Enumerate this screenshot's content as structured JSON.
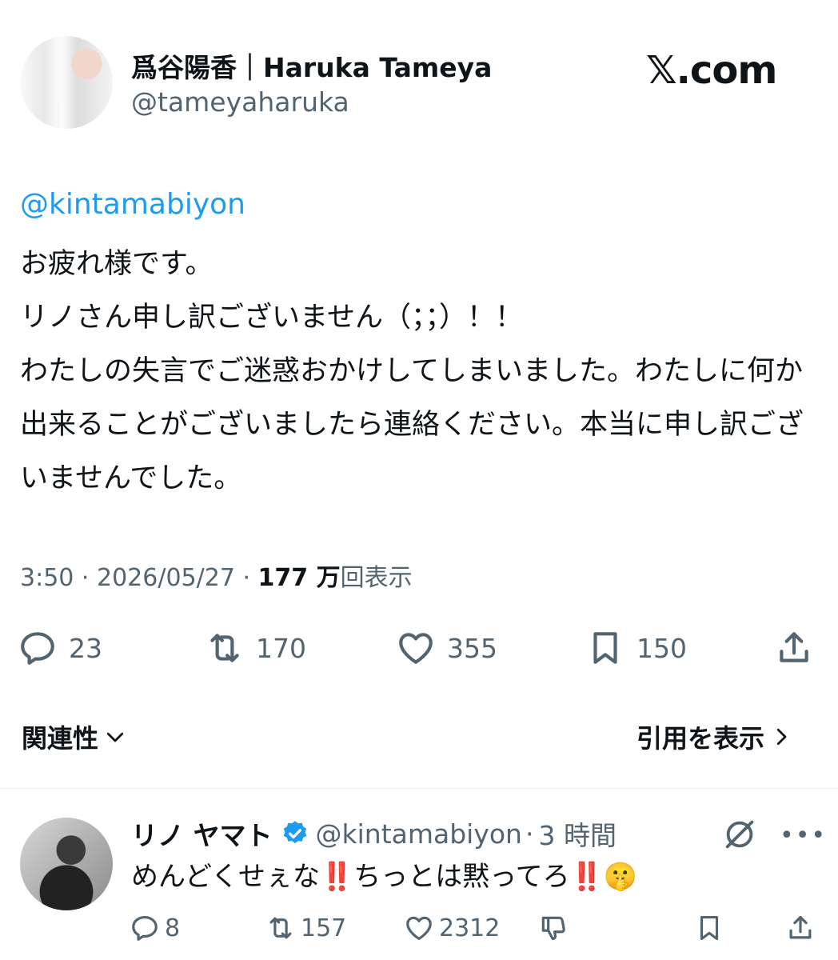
{
  "tweet": {
    "display_name": "爲谷陽香｜Haruka Tameya",
    "handle": "@tameyaharuka",
    "site_label": "𝕏.com",
    "mention": "@kintamabiyon",
    "body": "お疲れ様です。\nリノさん申し訳ございません（；；）！！\nわたしの失言でご迷惑おかけしてしまいました。わたしに何か出来ることがございましたら連絡ください。本当に申し訳ございませんでした。",
    "time": "3:50",
    "date": "2026/05/27",
    "views_count": "177 万",
    "views_label": "回表示",
    "replies": "23",
    "reposts": "170",
    "likes": "355",
    "bookmarks": "150",
    "related_label": "関連性",
    "quotes_label": "引用を表示"
  },
  "reply": {
    "display_name": "リノ ヤマト",
    "handle": "@kintamabiyon",
    "time_ago": "3 時間",
    "text": "めんどくせぇな‼️ちっとは黙ってろ‼️🤫",
    "replies": "8",
    "reposts": "157",
    "likes": "2312"
  },
  "colors": {
    "accent": "#1d9bf0",
    "muted": "#536471",
    "text": "#0f1419"
  },
  "icons": [
    "reply-icon",
    "repost-icon",
    "like-icon",
    "bookmark-icon",
    "share-icon",
    "chevron-down-icon",
    "chevron-right-icon",
    "verified-badge-icon",
    "grok-icon",
    "more-icon",
    "dislike-icon"
  ]
}
